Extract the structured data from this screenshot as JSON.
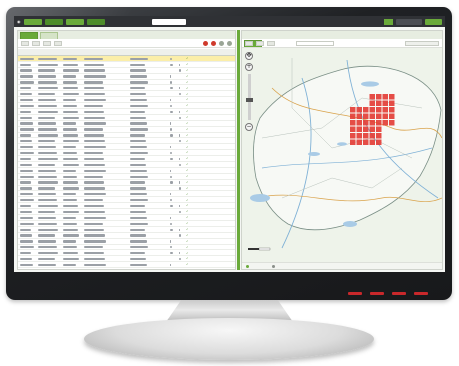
{
  "colors": {
    "brand_green": "#6aaa3a",
    "topbar_bg": "#2f3135",
    "highlight_row": "#fbeea9",
    "observation_red": "#e23a33",
    "bezel": "#1f2124"
  },
  "icons": {
    "zoom_in": "plus-icon",
    "zoom_out": "minus-icon",
    "pan": "pan-arrows-icon",
    "validated": "check-icon",
    "delete": "close-icon"
  },
  "table": {
    "row_count": 36,
    "highlighted_row_index": 0
  },
  "map": {
    "observation_grid_cells": 44
  }
}
